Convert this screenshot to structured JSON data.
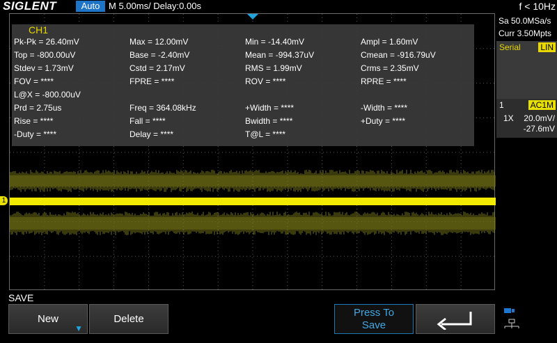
{
  "header": {
    "brand": "SIGLENT",
    "mode": "Auto",
    "timebase": "M 5.00ms/ Delay:0.00s",
    "frequency": "f < 10Hz"
  },
  "measurements": {
    "channel": "CH1",
    "rows": [
      [
        "Pk-Pk = 26.40mV",
        "Max = 12.00mV",
        "Min = -14.40mV",
        "Ampl = 1.60mV"
      ],
      [
        "Top = -800.00uV",
        "Base = -2.40mV",
        "Mean = -994.37uV",
        "Cmean = -916.79uV"
      ],
      [
        "Stdev = 1.73mV",
        "Cstd = 2.17mV",
        "RMS = 1.99mV",
        "Crms = 2.35mV"
      ],
      [
        "FOV = ****",
        "FPRE = ****",
        "ROV = ****",
        "RPRE = ****"
      ],
      [
        "L@X = -800.00uV"
      ],
      [
        "Prd = 2.75us",
        "Freq = 364.08kHz",
        "+Width = ****",
        "-Width = ****"
      ],
      [
        "Rise = ****",
        "Fall = ****",
        "Bwidth = ****",
        "+Duty = ****"
      ],
      [
        "-Duty = ****",
        "Delay = ****",
        "T@L = ****"
      ]
    ]
  },
  "side_panel": {
    "sample_rate": "Sa 50.0MSa/s",
    "memory": "Curr 3.50Mpts",
    "serial_label": "Serial",
    "serial_protocol": "LIN",
    "channel_num": "1",
    "coupling": "AC1M",
    "probe": "1X",
    "scale": "20.0mV/",
    "offset": "-27.6mV"
  },
  "waveform": {
    "channel_marker": "1",
    "color": "#e8e000"
  },
  "menu": {
    "title": "SAVE",
    "new_label": "New",
    "delete_label": "Delete",
    "press_save_line1": "Press To",
    "press_save_line2": "Save"
  },
  "colors": {
    "accent": "#1e74c6",
    "channel1": "#e8e000",
    "panel": "#3a3a3a"
  }
}
